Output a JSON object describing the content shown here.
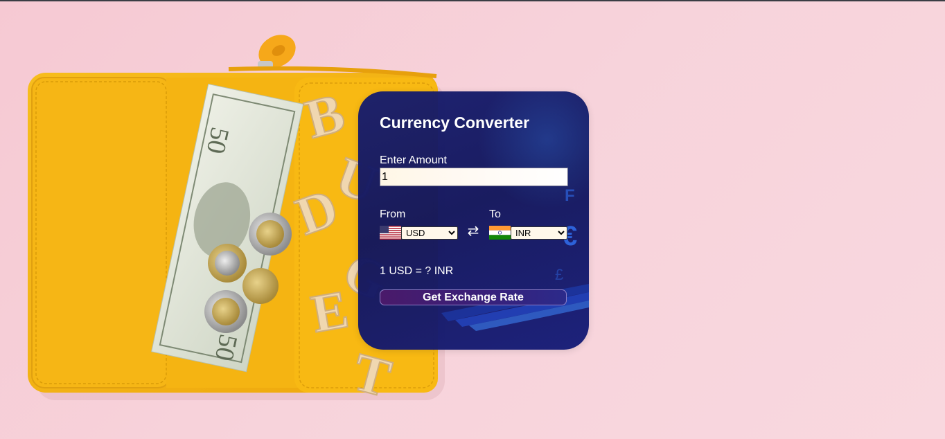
{
  "converter": {
    "title": "Currency Converter",
    "amount_label": "Enter Amount",
    "amount_value": "1",
    "from_label": "From",
    "to_label": "To",
    "from_currency": "USD",
    "to_currency": "INR",
    "from_flag": "us-flag",
    "to_flag": "india-flag",
    "swap_icon": "swap-arrows-icon",
    "rate_text": "1 USD = ? INR",
    "button_label": "Get Exchange Rate"
  },
  "background": {
    "description_icons": [
      "wallet-illustration",
      "banknote",
      "coins",
      "budget-letters"
    ],
    "colors": {
      "page_pink": "#f7d3db",
      "wallet_yellow": "#f6b10f",
      "card_navy": "#161c6e",
      "button_purple": "#4a1a6a"
    }
  }
}
